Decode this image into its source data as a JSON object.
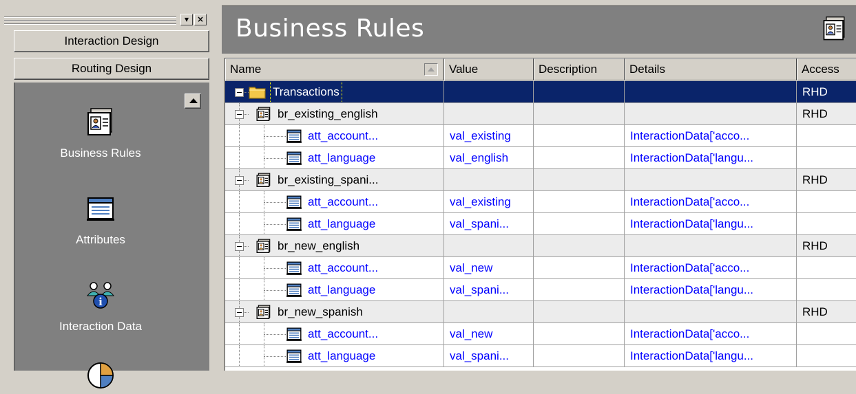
{
  "navigator": {
    "header_buttons": [
      "Interaction Design",
      "Routing Design"
    ],
    "items": [
      {
        "label": "Business Rules",
        "icon": "business-rule-icon"
      },
      {
        "label": "Attributes",
        "icon": "attributes-icon"
      },
      {
        "label": "Interaction Data",
        "icon": "interaction-data-icon"
      },
      {
        "label": "",
        "icon": "pie-chart-icon"
      }
    ],
    "titlebar_buttons": [
      "▾",
      "×"
    ]
  },
  "main": {
    "title": "Business Rules",
    "columns": [
      "Name",
      "Value",
      "Description",
      "Details",
      "Access"
    ],
    "rows": [
      {
        "name": "Transactions",
        "value": "",
        "description": "",
        "details": "",
        "access": "RHD",
        "type": "folder",
        "level": 0,
        "selected": true
      },
      {
        "name": "br_existing_english",
        "value": "",
        "description": "",
        "details": "",
        "access": "RHD",
        "type": "rule",
        "level": 1
      },
      {
        "name": "att_account...",
        "value": "val_existing",
        "description": "",
        "details": "InteractionData['acco...",
        "access": "",
        "type": "attribute",
        "level": 2
      },
      {
        "name": "att_language",
        "value": "val_english",
        "description": "",
        "details": "InteractionData['langu...",
        "access": "",
        "type": "attribute",
        "level": 2
      },
      {
        "name": "br_existing_spani...",
        "value": "",
        "description": "",
        "details": "",
        "access": "RHD",
        "type": "rule",
        "level": 1
      },
      {
        "name": "att_account...",
        "value": "val_existing",
        "description": "",
        "details": "InteractionData['acco...",
        "access": "",
        "type": "attribute",
        "level": 2
      },
      {
        "name": "att_language",
        "value": "val_spani...",
        "description": "",
        "details": "InteractionData['langu...",
        "access": "",
        "type": "attribute",
        "level": 2
      },
      {
        "name": "br_new_english",
        "value": "",
        "description": "",
        "details": "",
        "access": "RHD",
        "type": "rule",
        "level": 1
      },
      {
        "name": "att_account...",
        "value": "val_new",
        "description": "",
        "details": "InteractionData['acco...",
        "access": "",
        "type": "attribute",
        "level": 2
      },
      {
        "name": "att_language",
        "value": "val_spani...",
        "description": "",
        "details": "InteractionData['langu...",
        "access": "",
        "type": "attribute",
        "level": 2
      },
      {
        "name": "br_new_spanish",
        "value": "",
        "description": "",
        "details": "",
        "access": "RHD",
        "type": "rule",
        "level": 1
      },
      {
        "name": "att_account...",
        "value": "val_new",
        "description": "",
        "details": "InteractionData['acco...",
        "access": "",
        "type": "attribute",
        "level": 2
      },
      {
        "name": "att_language",
        "value": "val_spani...",
        "description": "",
        "details": "InteractionData['langu...",
        "access": "",
        "type": "attribute",
        "level": 2
      }
    ]
  },
  "colors": {
    "selection": "#0a246a",
    "link_text": "#0000ff",
    "panel_gray": "#808080",
    "chrome": "#d4d0c8"
  }
}
